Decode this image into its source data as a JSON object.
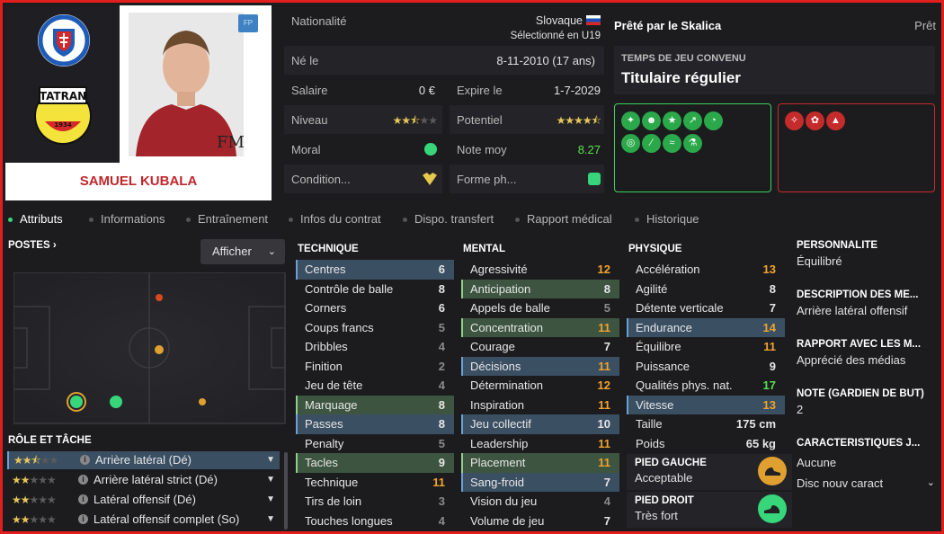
{
  "player": {
    "name": "SAMUEL KUBALA",
    "position_badge": "FP",
    "nationality_label": "Nationalité",
    "nationality": "Slovaque",
    "selection": "Sélectionné en U19",
    "born_label": "Né le",
    "born": "8-11-2010 (17 ans)",
    "salary_label": "Salaire",
    "salary": "0 €",
    "expires_label": "Expire le",
    "expires": "1-7-2029",
    "level_label": "Niveau",
    "level_stars": 2.5,
    "potential_label": "Potentiel",
    "potential_stars": 4.5,
    "moral_label": "Moral",
    "rating_label": "Note moy",
    "rating": "8.27",
    "condition_label": "Condition...",
    "form_label": "Forme ph..."
  },
  "loan": {
    "title": "Prêté par le Skalica",
    "status": "Prêt",
    "playtime_label": "TEMPS DE JEU CONVENU",
    "playtime": "Titulaire régulier"
  },
  "tabs": [
    "Attributs",
    "Informations",
    "Entraînement",
    "Infos du contrat",
    "Dispo. transfert",
    "Rapport médical",
    "Historique"
  ],
  "positions": {
    "title": "POSTES",
    "show_button": "Afficher"
  },
  "roles": {
    "title": "RÔLE ET TÂCHE",
    "items": [
      {
        "name": "Arrière latéral (Dé)",
        "stars": 2.5
      },
      {
        "name": "Arrière latéral strict (Dé)",
        "stars": 2
      },
      {
        "name": "Latéral offensif (Dé)",
        "stars": 2
      },
      {
        "name": "Latéral offensif complet (So)",
        "stars": 2
      }
    ]
  },
  "technique": {
    "title": "TECHNIQUE",
    "items": [
      {
        "name": "Centres",
        "value": "6",
        "hl": "blue",
        "c": "w"
      },
      {
        "name": "Contrôle de balle",
        "value": "8",
        "hl": "",
        "c": "w"
      },
      {
        "name": "Corners",
        "value": "6",
        "hl": "",
        "c": "w"
      },
      {
        "name": "Coups francs",
        "value": "5",
        "hl": "",
        "c": "g"
      },
      {
        "name": "Dribbles",
        "value": "4",
        "hl": "",
        "c": "g"
      },
      {
        "name": "Finition",
        "value": "2",
        "hl": "",
        "c": "g"
      },
      {
        "name": "Jeu de tête",
        "value": "4",
        "hl": "",
        "c": "g"
      },
      {
        "name": "Marquage",
        "value": "8",
        "hl": "green",
        "c": "w"
      },
      {
        "name": "Passes",
        "value": "8",
        "hl": "blue",
        "c": "w"
      },
      {
        "name": "Penalty",
        "value": "5",
        "hl": "",
        "c": "g"
      },
      {
        "name": "Tacles",
        "value": "9",
        "hl": "green",
        "c": "w"
      },
      {
        "name": "Technique",
        "value": "11",
        "hl": "",
        "c": "o"
      },
      {
        "name": "Tirs de loin",
        "value": "3",
        "hl": "",
        "c": "g"
      },
      {
        "name": "Touches longues",
        "value": "4",
        "hl": "",
        "c": "g"
      }
    ]
  },
  "mental": {
    "title": "MENTAL",
    "items": [
      {
        "name": "Agressivité",
        "value": "12",
        "hl": "",
        "c": "o"
      },
      {
        "name": "Anticipation",
        "value": "8",
        "hl": "green",
        "c": "w"
      },
      {
        "name": "Appels de balle",
        "value": "5",
        "hl": "",
        "c": "g"
      },
      {
        "name": "Concentration",
        "value": "11",
        "hl": "green",
        "c": "o"
      },
      {
        "name": "Courage",
        "value": "7",
        "hl": "",
        "c": "w"
      },
      {
        "name": "Décisions",
        "value": "11",
        "hl": "blue",
        "c": "o"
      },
      {
        "name": "Détermination",
        "value": "12",
        "hl": "",
        "c": "o"
      },
      {
        "name": "Inspiration",
        "value": "11",
        "hl": "",
        "c": "o"
      },
      {
        "name": "Jeu collectif",
        "value": "10",
        "hl": "blue",
        "c": "w"
      },
      {
        "name": "Leadership",
        "value": "11",
        "hl": "",
        "c": "o"
      },
      {
        "name": "Placement",
        "value": "11",
        "hl": "green",
        "c": "o"
      },
      {
        "name": "Sang-froid",
        "value": "7",
        "hl": "blue",
        "c": "w"
      },
      {
        "name": "Vision du jeu",
        "value": "4",
        "hl": "",
        "c": "g"
      },
      {
        "name": "Volume de jeu",
        "value": "7",
        "hl": "",
        "c": "w"
      }
    ]
  },
  "physique": {
    "title": "PHYSIQUE",
    "items": [
      {
        "name": "Accélération",
        "value": "13",
        "hl": "",
        "c": "o"
      },
      {
        "name": "Agilité",
        "value": "8",
        "hl": "",
        "c": "w"
      },
      {
        "name": "Détente verticale",
        "value": "7",
        "hl": "",
        "c": "w"
      },
      {
        "name": "Endurance",
        "value": "14",
        "hl": "blue",
        "c": "o"
      },
      {
        "name": "Équilibre",
        "value": "11",
        "hl": "",
        "c": "o"
      },
      {
        "name": "Puissance",
        "value": "9",
        "hl": "",
        "c": "w"
      },
      {
        "name": "Qualités phys. nat.",
        "value": "17",
        "hl": "",
        "c": "gr"
      },
      {
        "name": "Vitesse",
        "value": "13",
        "hl": "blue",
        "c": "o"
      }
    ],
    "height_label": "Taille",
    "height": "175 cm",
    "weight_label": "Poids",
    "weight": "65 kg",
    "left_foot_label": "PIED GAUCHE",
    "left_foot": "Acceptable",
    "right_foot_label": "PIED DROIT",
    "right_foot": "Très fort"
  },
  "right": {
    "personality_title": "PERSONNALITÉ",
    "personality": "Équilibré",
    "description_title": "DESCRIPTION DES MÉ...",
    "description": "Arrière latéral offensif",
    "media_title": "RAPPORT AVEC LES M...",
    "media": "Apprécié des médias",
    "gk_title": "NOTE (GARDIEN DE BUT)",
    "gk": "2",
    "traits_title": "CARACTÉRISTIQUES J...",
    "traits": "Aucune",
    "new_trait": "Disc nouv caract"
  },
  "colors": {
    "accent_green": "#37d67a",
    "orange": "#f1a32c",
    "frame_red": "#e01e1e"
  },
  "icons": [
    "slovakia-federation-logo",
    "tatran-logo",
    "player-photo",
    "slovakia-flag",
    "morale-icon",
    "condition-icon",
    "form-icon",
    "left-boot-icon",
    "right-boot-icon"
  ]
}
